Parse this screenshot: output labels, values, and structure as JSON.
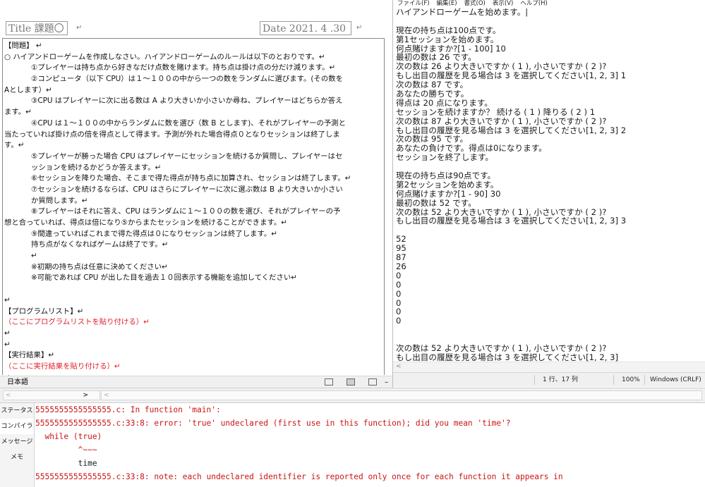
{
  "word": {
    "title_box": "Title  課題〇",
    "date_box": "Date 2021. 4 .30",
    "lines": [
      {
        "t": "【問題】   ↵",
        "cls": ""
      },
      {
        "t": "○  ハイアンドローゲームを作成しなさい。ハイアンドローゲームのルールは以下のとおりです。↵",
        "cls": ""
      },
      {
        "t": "①プレイヤーは持ち点から好きなだけ点数を賭けます。持ち点は掛け点の分だけ減ります。↵",
        "cls": "i1"
      },
      {
        "t": "②コンピュータ（以下 CPU）は１～１００の中から一つの数をランダムに選びます。(その数を",
        "cls": "i1"
      },
      {
        "t": "Aとします）↵",
        "cls": ""
      },
      {
        "t": "③CPU はプレイヤーに次に出る数は A より大きいか小さいか尋ね、プレイヤーはどちらか答え",
        "cls": "i1"
      },
      {
        "t": "ます。↵",
        "cls": ""
      },
      {
        "t": "④CPU は１～１００の中からランダムに数を選び（数 B とします)、それがプレイヤーの予測と",
        "cls": "i1"
      },
      {
        "t": "当たっていれば掛け点の倍を得点として得ます。予測が外れた場合得点０となりセッションは終了しま",
        "cls": ""
      },
      {
        "t": "す。↵",
        "cls": ""
      },
      {
        "t": "⑤プレイヤーが勝った場合 CPU はプレイヤーにセッションを続けるか質問し、プレイヤーはセ",
        "cls": "i1"
      },
      {
        "t": "ッションを続けるかどうか答えます。↵",
        "cls": "i1"
      },
      {
        "t": "⑥セッションを降りた場合、そこまで得た得点が持ち点に加算され、セッションは終了します。↵",
        "cls": "i1"
      },
      {
        "t": "⑦セッションを続けるならば、CPU はさらにプレイヤーに次に選ぶ数は B より大きいか小さい",
        "cls": "i1"
      },
      {
        "t": "か質問します。↵",
        "cls": "i1"
      },
      {
        "t": "⑧プレイヤーはそれに答え、CPU はランダムに１～１００の数を選び、それがプレイヤーの予",
        "cls": "i1"
      },
      {
        "t": "想と合っていれば、得点は倍になり⑤からまたセッションを続けることができます。↵",
        "cls": ""
      },
      {
        "t": "⑨間違っていればこれまで得た得点は０になりセッションは終了します。↵",
        "cls": "i1"
      },
      {
        "t": "持ち点がなくなればゲームは終了です。↵",
        "cls": "i1"
      },
      {
        "t": "↵",
        "cls": "i1"
      },
      {
        "t": "※初期の持ち点は任意に決めてください↵",
        "cls": "i1"
      },
      {
        "t": "※可能であれば CPU が出した目を過去１０回表示する機能を追加してください↵",
        "cls": "i1"
      },
      {
        "t": "",
        "cls": ""
      },
      {
        "t": "↵",
        "cls": ""
      },
      {
        "t": "【プログラムリスト】↵",
        "cls": ""
      },
      {
        "t": "（ここにプログラムリストを貼り付ける）↵",
        "cls": "red"
      },
      {
        "t": "↵",
        "cls": ""
      },
      {
        "t": "↵",
        "cls": ""
      },
      {
        "t": "【実行結果】↵",
        "cls": ""
      },
      {
        "t": "（ここに実行結果を貼り付ける）↵",
        "cls": "red"
      },
      {
        "t": "↵",
        "cls": ""
      }
    ],
    "status_language": "日本語",
    "status_minus": "–"
  },
  "notepad": {
    "menu": [
      "ファイル(F)",
      "編集(E)",
      "書式(O)",
      "表示(V)",
      "ヘルプ(H)"
    ],
    "lines": [
      "ハイアンドローゲームを始めます。|",
      "",
      "現在の持ち点は100点です。",
      "第1セッションを始めます。",
      "何点賭けますか?[1 - 100] 10",
      "最初の数は 26 です。",
      "次の数は 26 より大きいですか ( 1 ), 小さいですか ( 2 )?",
      "もし出目の履歴を見る場合は 3 を選択してください[1, 2, 3] 1",
      "次の数は 87 です。",
      "あなたの勝ちです。",
      "得点は 20 点になります。",
      "セッションを続けますか？  続ける ( 1 ) 降りる ( 2 )  1",
      "次の数は 87 より大きいですか ( 1 ), 小さいですか ( 2 )?",
      "もし出目の履歴を見る場合は 3 を選択してください[1, 2, 3] 2",
      "次の数は 95 です。",
      "あなたの負けです。得点は0になります。",
      "セッションを終了します。",
      "",
      "現在の持ち点は90点です。",
      "第2セッションを始めます。",
      "何点賭けますか?[1 - 90] 30",
      "最初の数は 52 です。",
      "次の数は 52 より大きいですか ( 1 ), 小さいですか ( 2 )?",
      "もし出目の履歴を見る場合は 3 を選択してください[1, 2, 3] 3",
      "",
      "52",
      "95",
      "87",
      "26",
      "0",
      "0",
      "0",
      "0",
      "0",
      "0",
      "",
      "",
      "次の数は 52 より大きいですか ( 1 ), 小さいですか ( 2 )?",
      "もし出目の履歴を見る場合は 3 を選択してください[1, 2, 3]"
    ],
    "status_position": "1 行、17 列",
    "status_zoom": "100%",
    "status_encoding": "Windows (CRLF)"
  },
  "tabs": [
    "ステータス",
    "コンパイラ",
    "メッセージ",
    "メモ"
  ],
  "output": {
    "lines": [
      {
        "t": "5555555555555555.c: In function 'main':",
        "cls": "err"
      },
      {
        "t": "5555555555555555.c:33:8: error: 'true' undeclared (first use in this function); did you mean 'time'?",
        "cls": "err"
      },
      {
        "t": "  while (true)",
        "cls": "src"
      },
      {
        "t": "         ^~~~",
        "cls": "caret"
      },
      {
        "t": "         time",
        "cls": "plain"
      },
      {
        "t": "5555555555555555.c:33:8: note: each undeclared identifier is reported only once for each function it appears in",
        "cls": "err"
      }
    ]
  },
  "arrows": {
    "left": "<",
    "right": ">"
  },
  "colors": {
    "error": "#cc1414",
    "placeholder_red": "#e0202a"
  }
}
